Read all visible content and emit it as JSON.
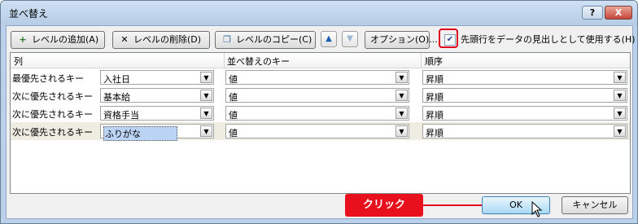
{
  "window": {
    "title": "並べ替え",
    "help": "?",
    "close": "X"
  },
  "toolbar": {
    "add_level": "レベルの追加(A)",
    "delete_level": "レベルの削除(D)",
    "copy_level": "レベルのコピー(C)",
    "move_up": "▲",
    "move_down": "▼",
    "options": "オプション(O)...",
    "header_checkbox_label": "先頭行をデータの見出しとして使用する(H)",
    "header_checkbox_checked": true
  },
  "grid": {
    "headers": {
      "column": "列",
      "sort_on": "並べ替えのキー",
      "order": "順序"
    },
    "rows": [
      {
        "label": "最優先されるキー",
        "column": "入社日",
        "sort_on": "値",
        "order": "昇順"
      },
      {
        "label": "次に優先されるキー",
        "column": "基本給",
        "sort_on": "値",
        "order": "昇順"
      },
      {
        "label": "次に優先されるキー",
        "column": "資格手当",
        "sort_on": "値",
        "order": "昇順"
      },
      {
        "label": "次に優先されるキー",
        "column": "ふりがな",
        "sort_on": "値",
        "order": "昇順"
      }
    ]
  },
  "annotation": "クリック",
  "footer": {
    "ok": "OK",
    "cancel": "キャンセル"
  },
  "colors": {
    "annotation": "#e8101d",
    "highlight_border": "#e0001a",
    "title_bar": "#b9d1ea"
  }
}
